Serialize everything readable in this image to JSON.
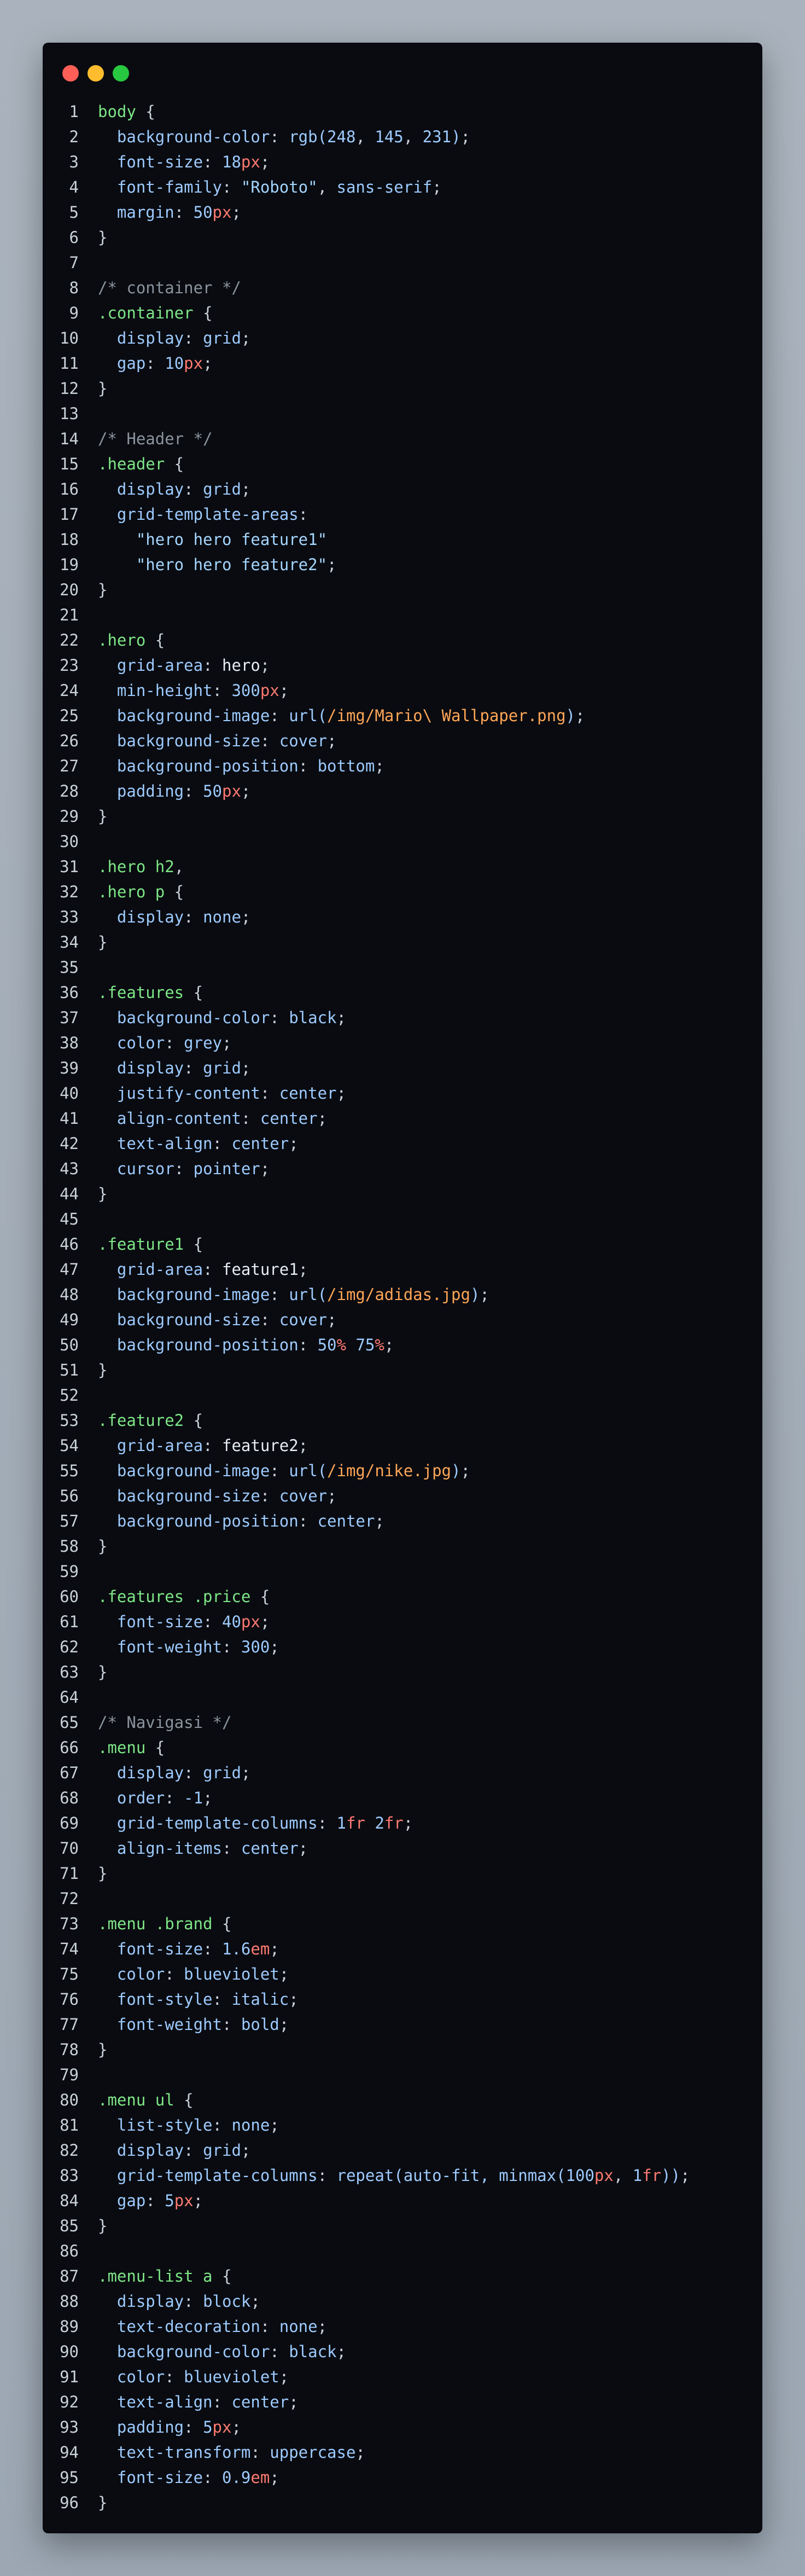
{
  "window": {
    "buttons": [
      {
        "name": "close",
        "color": "#ff5f57"
      },
      {
        "name": "minimize",
        "color": "#febc2e"
      },
      {
        "name": "zoom",
        "color": "#28c840"
      }
    ]
  },
  "code_lines": [
    [
      [
        "sel",
        "body"
      ],
      [
        "pun",
        " {"
      ]
    ],
    [
      [
        "pun",
        "  "
      ],
      [
        "prop",
        "background-color"
      ],
      [
        "pun",
        ": "
      ],
      [
        "val",
        "rgb("
      ],
      [
        "val",
        "248"
      ],
      [
        "pun",
        ", "
      ],
      [
        "val",
        "145"
      ],
      [
        "pun",
        ", "
      ],
      [
        "val",
        "231"
      ],
      [
        "val",
        ")"
      ],
      [
        "pun",
        ";"
      ]
    ],
    [
      [
        "pun",
        "  "
      ],
      [
        "prop",
        "font-size"
      ],
      [
        "pun",
        ": "
      ],
      [
        "val",
        "18"
      ],
      [
        "unit",
        "px"
      ],
      [
        "pun",
        ";"
      ]
    ],
    [
      [
        "pun",
        "  "
      ],
      [
        "prop",
        "font-family"
      ],
      [
        "pun",
        ": "
      ],
      [
        "str",
        "\"Roboto\""
      ],
      [
        "pun",
        ", "
      ],
      [
        "val",
        "sans-serif"
      ],
      [
        "pun",
        ";"
      ]
    ],
    [
      [
        "pun",
        "  "
      ],
      [
        "prop",
        "margin"
      ],
      [
        "pun",
        ": "
      ],
      [
        "val",
        "50"
      ],
      [
        "unit",
        "px"
      ],
      [
        "pun",
        ";"
      ]
    ],
    [
      [
        "pun",
        "}"
      ]
    ],
    [],
    [
      [
        "cm",
        "/* container */"
      ]
    ],
    [
      [
        "sel",
        ".container"
      ],
      [
        "pun",
        " {"
      ]
    ],
    [
      [
        "pun",
        "  "
      ],
      [
        "prop",
        "display"
      ],
      [
        "pun",
        ": "
      ],
      [
        "val",
        "grid"
      ],
      [
        "pun",
        ";"
      ]
    ],
    [
      [
        "pun",
        "  "
      ],
      [
        "prop",
        "gap"
      ],
      [
        "pun",
        ": "
      ],
      [
        "val",
        "10"
      ],
      [
        "unit",
        "px"
      ],
      [
        "pun",
        ";"
      ]
    ],
    [
      [
        "pun",
        "}"
      ]
    ],
    [],
    [
      [
        "cm",
        "/* Header */"
      ]
    ],
    [
      [
        "sel",
        ".header"
      ],
      [
        "pun",
        " {"
      ]
    ],
    [
      [
        "pun",
        "  "
      ],
      [
        "prop",
        "display"
      ],
      [
        "pun",
        ": "
      ],
      [
        "val",
        "grid"
      ],
      [
        "pun",
        ";"
      ]
    ],
    [
      [
        "pun",
        "  "
      ],
      [
        "prop",
        "grid-template-areas"
      ],
      [
        "pun",
        ":"
      ]
    ],
    [
      [
        "pun",
        "    "
      ],
      [
        "str",
        "\"hero hero feature1\""
      ]
    ],
    [
      [
        "pun",
        "    "
      ],
      [
        "str",
        "\"hero hero feature2\""
      ],
      [
        "pun",
        ";"
      ]
    ],
    [
      [
        "pun",
        "}"
      ]
    ],
    [],
    [
      [
        "sel",
        ".hero"
      ],
      [
        "pun",
        " {"
      ]
    ],
    [
      [
        "pun",
        "  "
      ],
      [
        "prop",
        "grid-area"
      ],
      [
        "pun",
        ": "
      ],
      [
        "id",
        "hero"
      ],
      [
        "pun",
        ";"
      ]
    ],
    [
      [
        "pun",
        "  "
      ],
      [
        "prop",
        "min-height"
      ],
      [
        "pun",
        ": "
      ],
      [
        "val",
        "300"
      ],
      [
        "unit",
        "px"
      ],
      [
        "pun",
        ";"
      ]
    ],
    [
      [
        "pun",
        "  "
      ],
      [
        "prop",
        "background-image"
      ],
      [
        "pun",
        ": "
      ],
      [
        "val",
        "url("
      ],
      [
        "url",
        "/img/Mario\\ Wallpaper.png"
      ],
      [
        "val",
        ")"
      ],
      [
        "pun",
        ";"
      ]
    ],
    [
      [
        "pun",
        "  "
      ],
      [
        "prop",
        "background-size"
      ],
      [
        "pun",
        ": "
      ],
      [
        "val",
        "cover"
      ],
      [
        "pun",
        ";"
      ]
    ],
    [
      [
        "pun",
        "  "
      ],
      [
        "prop",
        "background-position"
      ],
      [
        "pun",
        ": "
      ],
      [
        "val",
        "bottom"
      ],
      [
        "pun",
        ";"
      ]
    ],
    [
      [
        "pun",
        "  "
      ],
      [
        "prop",
        "padding"
      ],
      [
        "pun",
        ": "
      ],
      [
        "val",
        "50"
      ],
      [
        "unit",
        "px"
      ],
      [
        "pun",
        ";"
      ]
    ],
    [
      [
        "pun",
        "}"
      ]
    ],
    [],
    [
      [
        "sel",
        ".hero h2"
      ],
      [
        "pun",
        ","
      ]
    ],
    [
      [
        "sel",
        ".hero p"
      ],
      [
        "pun",
        " {"
      ]
    ],
    [
      [
        "pun",
        "  "
      ],
      [
        "prop",
        "display"
      ],
      [
        "pun",
        ": "
      ],
      [
        "val",
        "none"
      ],
      [
        "pun",
        ";"
      ]
    ],
    [
      [
        "pun",
        "}"
      ]
    ],
    [],
    [
      [
        "sel",
        ".features"
      ],
      [
        "pun",
        " {"
      ]
    ],
    [
      [
        "pun",
        "  "
      ],
      [
        "prop",
        "background-color"
      ],
      [
        "pun",
        ": "
      ],
      [
        "val",
        "black"
      ],
      [
        "pun",
        ";"
      ]
    ],
    [
      [
        "pun",
        "  "
      ],
      [
        "prop",
        "color"
      ],
      [
        "pun",
        ": "
      ],
      [
        "val",
        "grey"
      ],
      [
        "pun",
        ";"
      ]
    ],
    [
      [
        "pun",
        "  "
      ],
      [
        "prop",
        "display"
      ],
      [
        "pun",
        ": "
      ],
      [
        "val",
        "grid"
      ],
      [
        "pun",
        ";"
      ]
    ],
    [
      [
        "pun",
        "  "
      ],
      [
        "prop",
        "justify-content"
      ],
      [
        "pun",
        ": "
      ],
      [
        "val",
        "center"
      ],
      [
        "pun",
        ";"
      ]
    ],
    [
      [
        "pun",
        "  "
      ],
      [
        "prop",
        "align-content"
      ],
      [
        "pun",
        ": "
      ],
      [
        "val",
        "center"
      ],
      [
        "pun",
        ";"
      ]
    ],
    [
      [
        "pun",
        "  "
      ],
      [
        "prop",
        "text-align"
      ],
      [
        "pun",
        ": "
      ],
      [
        "val",
        "center"
      ],
      [
        "pun",
        ";"
      ]
    ],
    [
      [
        "pun",
        "  "
      ],
      [
        "prop",
        "cursor"
      ],
      [
        "pun",
        ": "
      ],
      [
        "val",
        "pointer"
      ],
      [
        "pun",
        ";"
      ]
    ],
    [
      [
        "pun",
        "}"
      ]
    ],
    [],
    [
      [
        "sel",
        ".feature1"
      ],
      [
        "pun",
        " {"
      ]
    ],
    [
      [
        "pun",
        "  "
      ],
      [
        "prop",
        "grid-area"
      ],
      [
        "pun",
        ": "
      ],
      [
        "id",
        "feature1"
      ],
      [
        "pun",
        ";"
      ]
    ],
    [
      [
        "pun",
        "  "
      ],
      [
        "prop",
        "background-image"
      ],
      [
        "pun",
        ": "
      ],
      [
        "val",
        "url("
      ],
      [
        "url",
        "/img/adidas.jpg"
      ],
      [
        "val",
        ")"
      ],
      [
        "pun",
        ";"
      ]
    ],
    [
      [
        "pun",
        "  "
      ],
      [
        "prop",
        "background-size"
      ],
      [
        "pun",
        ": "
      ],
      [
        "val",
        "cover"
      ],
      [
        "pun",
        ";"
      ]
    ],
    [
      [
        "pun",
        "  "
      ],
      [
        "prop",
        "background-position"
      ],
      [
        "pun",
        ": "
      ],
      [
        "val",
        "50"
      ],
      [
        "unit",
        "%"
      ],
      [
        "pun",
        " "
      ],
      [
        "val",
        "75"
      ],
      [
        "unit",
        "%"
      ],
      [
        "pun",
        ";"
      ]
    ],
    [
      [
        "pun",
        "}"
      ]
    ],
    [],
    [
      [
        "sel",
        ".feature2"
      ],
      [
        "pun",
        " {"
      ]
    ],
    [
      [
        "pun",
        "  "
      ],
      [
        "prop",
        "grid-area"
      ],
      [
        "pun",
        ": "
      ],
      [
        "id",
        "feature2"
      ],
      [
        "pun",
        ";"
      ]
    ],
    [
      [
        "pun",
        "  "
      ],
      [
        "prop",
        "background-image"
      ],
      [
        "pun",
        ": "
      ],
      [
        "val",
        "url("
      ],
      [
        "url",
        "/img/nike.jpg"
      ],
      [
        "val",
        ")"
      ],
      [
        "pun",
        ";"
      ]
    ],
    [
      [
        "pun",
        "  "
      ],
      [
        "prop",
        "background-size"
      ],
      [
        "pun",
        ": "
      ],
      [
        "val",
        "cover"
      ],
      [
        "pun",
        ";"
      ]
    ],
    [
      [
        "pun",
        "  "
      ],
      [
        "prop",
        "background-position"
      ],
      [
        "pun",
        ": "
      ],
      [
        "val",
        "center"
      ],
      [
        "pun",
        ";"
      ]
    ],
    [
      [
        "pun",
        "}"
      ]
    ],
    [],
    [
      [
        "sel",
        ".features .price"
      ],
      [
        "pun",
        " {"
      ]
    ],
    [
      [
        "pun",
        "  "
      ],
      [
        "prop",
        "font-size"
      ],
      [
        "pun",
        ": "
      ],
      [
        "val",
        "40"
      ],
      [
        "unit",
        "px"
      ],
      [
        "pun",
        ";"
      ]
    ],
    [
      [
        "pun",
        "  "
      ],
      [
        "prop",
        "font-weight"
      ],
      [
        "pun",
        ": "
      ],
      [
        "val",
        "300"
      ],
      [
        "pun",
        ";"
      ]
    ],
    [
      [
        "pun",
        "}"
      ]
    ],
    [],
    [
      [
        "cm",
        "/* Navigasi */"
      ]
    ],
    [
      [
        "sel",
        ".menu"
      ],
      [
        "pun",
        " {"
      ]
    ],
    [
      [
        "pun",
        "  "
      ],
      [
        "prop",
        "display"
      ],
      [
        "pun",
        ": "
      ],
      [
        "val",
        "grid"
      ],
      [
        "pun",
        ";"
      ]
    ],
    [
      [
        "pun",
        "  "
      ],
      [
        "prop",
        "order"
      ],
      [
        "pun",
        ": "
      ],
      [
        "val",
        "-1"
      ],
      [
        "pun",
        ";"
      ]
    ],
    [
      [
        "pun",
        "  "
      ],
      [
        "prop",
        "grid-template-columns"
      ],
      [
        "pun",
        ": "
      ],
      [
        "val",
        "1"
      ],
      [
        "unit",
        "fr"
      ],
      [
        "pun",
        " "
      ],
      [
        "val",
        "2"
      ],
      [
        "unit",
        "fr"
      ],
      [
        "pun",
        ";"
      ]
    ],
    [
      [
        "pun",
        "  "
      ],
      [
        "prop",
        "align-items"
      ],
      [
        "pun",
        ": "
      ],
      [
        "val",
        "center"
      ],
      [
        "pun",
        ";"
      ]
    ],
    [
      [
        "pun",
        "}"
      ]
    ],
    [],
    [
      [
        "sel",
        ".menu .brand"
      ],
      [
        "pun",
        " {"
      ]
    ],
    [
      [
        "pun",
        "  "
      ],
      [
        "prop",
        "font-size"
      ],
      [
        "pun",
        ": "
      ],
      [
        "val",
        "1.6"
      ],
      [
        "unit",
        "em"
      ],
      [
        "pun",
        ";"
      ]
    ],
    [
      [
        "pun",
        "  "
      ],
      [
        "prop",
        "color"
      ],
      [
        "pun",
        ": "
      ],
      [
        "val",
        "blueviolet"
      ],
      [
        "pun",
        ";"
      ]
    ],
    [
      [
        "pun",
        "  "
      ],
      [
        "prop",
        "font-style"
      ],
      [
        "pun",
        ": "
      ],
      [
        "val",
        "italic"
      ],
      [
        "pun",
        ";"
      ]
    ],
    [
      [
        "pun",
        "  "
      ],
      [
        "prop",
        "font-weight"
      ],
      [
        "pun",
        ": "
      ],
      [
        "val",
        "bold"
      ],
      [
        "pun",
        ";"
      ]
    ],
    [
      [
        "pun",
        "}"
      ]
    ],
    [],
    [
      [
        "sel",
        ".menu ul"
      ],
      [
        "pun",
        " {"
      ]
    ],
    [
      [
        "pun",
        "  "
      ],
      [
        "prop",
        "list-style"
      ],
      [
        "pun",
        ": "
      ],
      [
        "val",
        "none"
      ],
      [
        "pun",
        ";"
      ]
    ],
    [
      [
        "pun",
        "  "
      ],
      [
        "prop",
        "display"
      ],
      [
        "pun",
        ": "
      ],
      [
        "val",
        "grid"
      ],
      [
        "pun",
        ";"
      ]
    ],
    [
      [
        "pun",
        "  "
      ],
      [
        "prop",
        "grid-template-columns"
      ],
      [
        "pun",
        ": "
      ],
      [
        "val",
        "repeat(auto-fit, minmax("
      ],
      [
        "val",
        "100"
      ],
      [
        "unit",
        "px"
      ],
      [
        "pun",
        ", "
      ],
      [
        "val",
        "1"
      ],
      [
        "unit",
        "fr"
      ],
      [
        "val",
        "))"
      ],
      [
        "pun",
        ";"
      ]
    ],
    [
      [
        "pun",
        "  "
      ],
      [
        "prop",
        "gap"
      ],
      [
        "pun",
        ": "
      ],
      [
        "val",
        "5"
      ],
      [
        "unit",
        "px"
      ],
      [
        "pun",
        ";"
      ]
    ],
    [
      [
        "pun",
        "}"
      ]
    ],
    [],
    [
      [
        "sel",
        ".menu-list a"
      ],
      [
        "pun",
        " {"
      ]
    ],
    [
      [
        "pun",
        "  "
      ],
      [
        "prop",
        "display"
      ],
      [
        "pun",
        ": "
      ],
      [
        "val",
        "block"
      ],
      [
        "pun",
        ";"
      ]
    ],
    [
      [
        "pun",
        "  "
      ],
      [
        "prop",
        "text-decoration"
      ],
      [
        "pun",
        ": "
      ],
      [
        "val",
        "none"
      ],
      [
        "pun",
        ";"
      ]
    ],
    [
      [
        "pun",
        "  "
      ],
      [
        "prop",
        "background-color"
      ],
      [
        "pun",
        ": "
      ],
      [
        "val",
        "black"
      ],
      [
        "pun",
        ";"
      ]
    ],
    [
      [
        "pun",
        "  "
      ],
      [
        "prop",
        "color"
      ],
      [
        "pun",
        ": "
      ],
      [
        "val",
        "blueviolet"
      ],
      [
        "pun",
        ";"
      ]
    ],
    [
      [
        "pun",
        "  "
      ],
      [
        "prop",
        "text-align"
      ],
      [
        "pun",
        ": "
      ],
      [
        "val",
        "center"
      ],
      [
        "pun",
        ";"
      ]
    ],
    [
      [
        "pun",
        "  "
      ],
      [
        "prop",
        "padding"
      ],
      [
        "pun",
        ": "
      ],
      [
        "val",
        "5"
      ],
      [
        "unit",
        "px"
      ],
      [
        "pun",
        ";"
      ]
    ],
    [
      [
        "pun",
        "  "
      ],
      [
        "prop",
        "text-transform"
      ],
      [
        "pun",
        ": "
      ],
      [
        "val",
        "uppercase"
      ],
      [
        "pun",
        ";"
      ]
    ],
    [
      [
        "pun",
        "  "
      ],
      [
        "prop",
        "font-size"
      ],
      [
        "pun",
        ": "
      ],
      [
        "val",
        "0.9"
      ],
      [
        "unit",
        "em"
      ],
      [
        "pun",
        ";"
      ]
    ],
    [
      [
        "pun",
        "}"
      ]
    ]
  ]
}
